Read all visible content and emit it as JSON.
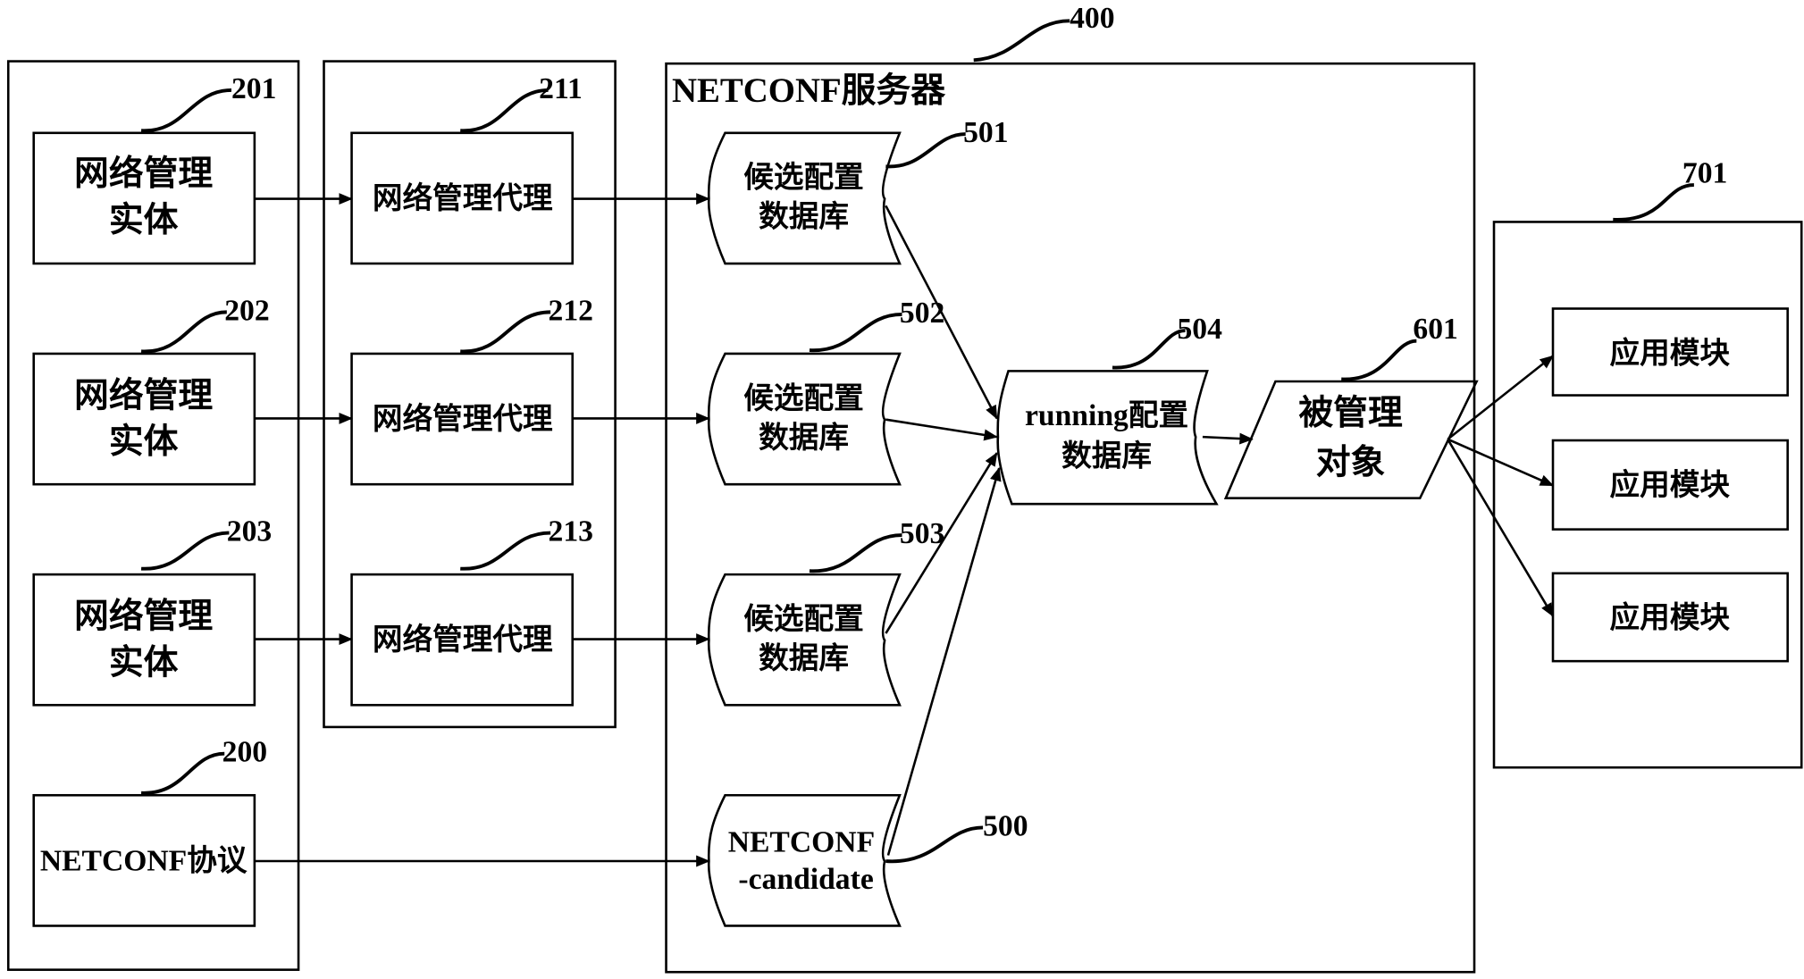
{
  "server": {
    "title": "NETCONF服务器",
    "ref": "400"
  },
  "entities": [
    {
      "ref": "201",
      "line1": "网络管理",
      "line2": "实体"
    },
    {
      "ref": "202",
      "line1": "网络管理",
      "line2": "实体"
    },
    {
      "ref": "203",
      "line1": "网络管理",
      "line2": "实体"
    }
  ],
  "protocol": {
    "ref": "200",
    "label": "NETCONF协议"
  },
  "agents": [
    {
      "ref": "211",
      "label": "网络管理代理"
    },
    {
      "ref": "212",
      "label": "网络管理代理"
    },
    {
      "ref": "213",
      "label": "网络管理代理"
    }
  ],
  "candidates": [
    {
      "ref": "501",
      "line1": "候选配置",
      "line2": "数据库"
    },
    {
      "ref": "502",
      "line1": "候选配置",
      "line2": "数据库"
    },
    {
      "ref": "503",
      "line1": "候选配置",
      "line2": "数据库"
    }
  ],
  "netconf_candidate": {
    "ref": "500",
    "line1": "NETCONF",
    "line2": "-candidate"
  },
  "running": {
    "ref": "504",
    "line1": "running配置",
    "line2": "数据库"
  },
  "managed": {
    "ref": "601",
    "line1": "被管理",
    "line2": "对象"
  },
  "apps": {
    "ref": "701",
    "items": [
      "应用模块",
      "应用模块",
      "应用模块"
    ]
  }
}
